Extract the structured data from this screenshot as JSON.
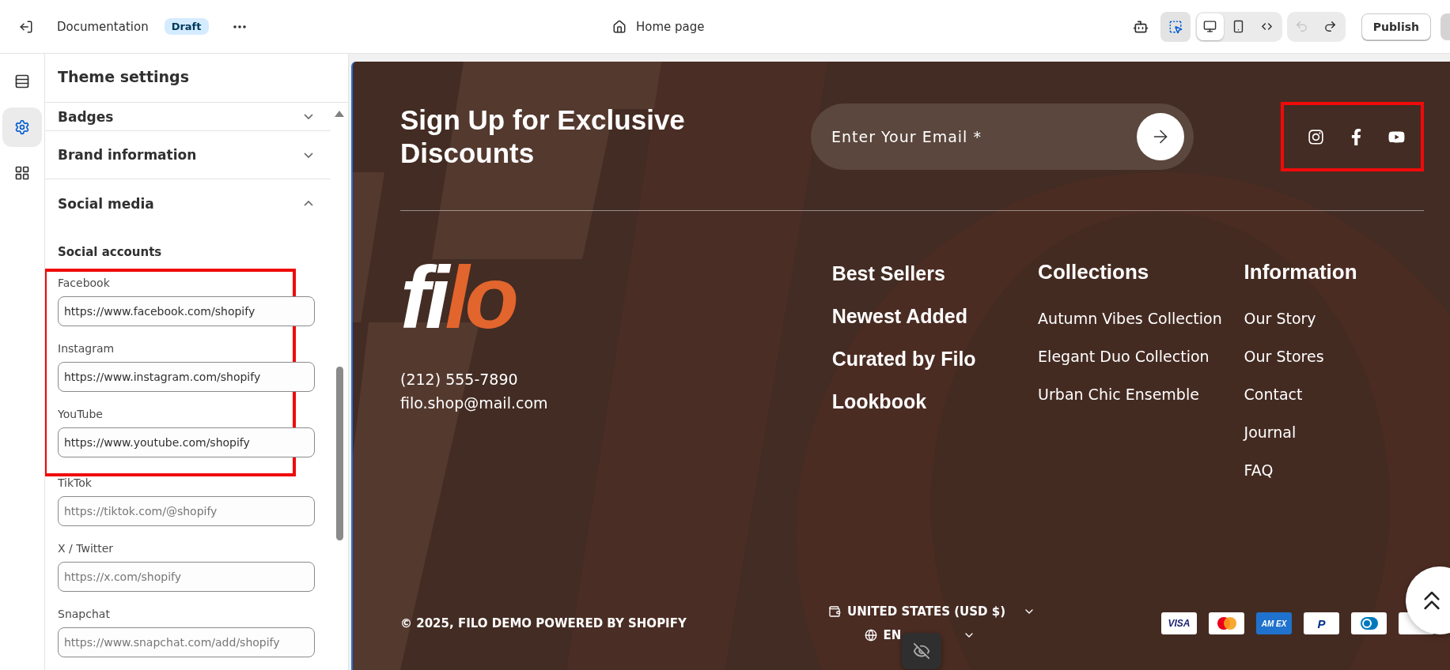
{
  "topbar": {
    "document": "Documentation",
    "status": "Draft",
    "page": "Home page",
    "inspector_active": true,
    "devices": [
      {
        "kind": "desktop",
        "selected": true
      },
      {
        "kind": "mobile",
        "selected": false
      },
      {
        "kind": "fullwidth",
        "selected": false
      }
    ],
    "undo_disabled": true,
    "redo_disabled": false,
    "publish": "Publish"
  },
  "rail": [
    {
      "kind": "sections",
      "selected": false
    },
    {
      "kind": "settings",
      "selected": true
    },
    {
      "kind": "apps",
      "selected": false
    }
  ],
  "sidebar": {
    "title": "Theme settings",
    "groups": [
      {
        "label": "Badges",
        "expanded": false
      },
      {
        "label": "Brand information",
        "expanded": false
      },
      {
        "label": "Social media",
        "expanded": true
      }
    ],
    "subheading": "Social accounts",
    "fields": [
      {
        "label": "Facebook",
        "value": "https://www.facebook.com/shopify",
        "highlighted": true
      },
      {
        "label": "Instagram",
        "value": "https://www.instagram.com/shopify",
        "highlighted": true
      },
      {
        "label": "YouTube",
        "value": "https://www.youtube.com/shopify",
        "highlighted": true
      },
      {
        "label": "TikTok",
        "placeholder": "https://tiktok.com/@shopify",
        "highlighted": false
      },
      {
        "label": "X / Twitter",
        "placeholder": "https://x.com/shopify",
        "highlighted": false
      },
      {
        "label": "Snapchat",
        "placeholder": "https://www.snapchat.com/add/shopify",
        "highlighted": false
      }
    ]
  },
  "footer": {
    "signup_heading": "Sign Up for Exclusive Discounts",
    "email_placeholder": "Enter Your Email *",
    "social": {
      "highlighted": true,
      "icons": [
        {
          "kind": "instagram"
        },
        {
          "kind": "facebook"
        },
        {
          "kind": "youtube"
        }
      ]
    },
    "logo": {
      "lead": "fi",
      "accent": "lo"
    },
    "phone": "(212) 555-7890",
    "email": "filo.shop@mail.com",
    "column_1": [
      "Best Sellers",
      "Newest Added",
      "Curated by Filo",
      "Lookbook"
    ],
    "menus": [
      {
        "heading": "Collections",
        "links": [
          "Autumn Vibes Collection",
          "Elegant Duo Collection",
          "Urban Chic Ensemble"
        ]
      },
      {
        "heading": "Information",
        "links": [
          "Our Story",
          "Our Stores",
          "Contact",
          "Journal",
          "FAQ"
        ]
      }
    ],
    "copyright": "© 2025, FILO DEMO POWERED BY SHOPIFY",
    "country": "UNITED STATES (USD $)",
    "language": "EN",
    "payments": [
      {
        "kind": "visa",
        "label": "VISA"
      },
      {
        "kind": "mastercard"
      },
      {
        "kind": "amex",
        "label": "AM EX"
      },
      {
        "kind": "paypal",
        "label": "P"
      },
      {
        "kind": "diners"
      },
      {
        "kind": "card"
      }
    ]
  }
}
